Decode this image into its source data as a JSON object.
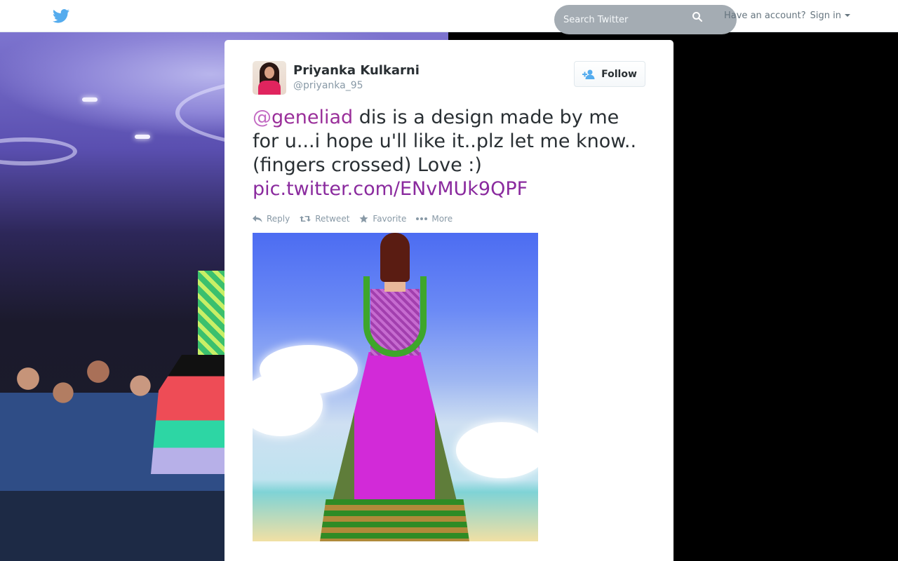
{
  "topbar": {
    "logo_icon": "twitter-bird-icon",
    "search_placeholder": "Search Twitter",
    "account_prompt": "Have an account?",
    "signin_label": "Sign in",
    "colors": {
      "brand": "#55acee",
      "search_bg": "#a4acb3"
    }
  },
  "tweet": {
    "author": {
      "fullname": "Priyanka Kulkarni",
      "username": "@priyanka_95"
    },
    "follow_label": "Follow",
    "text": {
      "mention_at": "@",
      "mention_name": "geneliad",
      "body_line1": " dis is a design made by me for u...i hope u'll like it..plz let me know..",
      "body_line2": "(fingers crossed) Love :)",
      "pic_link": "pic.twitter.com/ENvMUk9QPF"
    },
    "actions": {
      "reply": "Reply",
      "retweet": "Retweet",
      "favorite": "Favorite",
      "more": "More"
    },
    "colors": {
      "mention": "#9a2f9a",
      "link": "#8a2a9e",
      "text": "#292f33",
      "muted": "#8899a6"
    }
  }
}
